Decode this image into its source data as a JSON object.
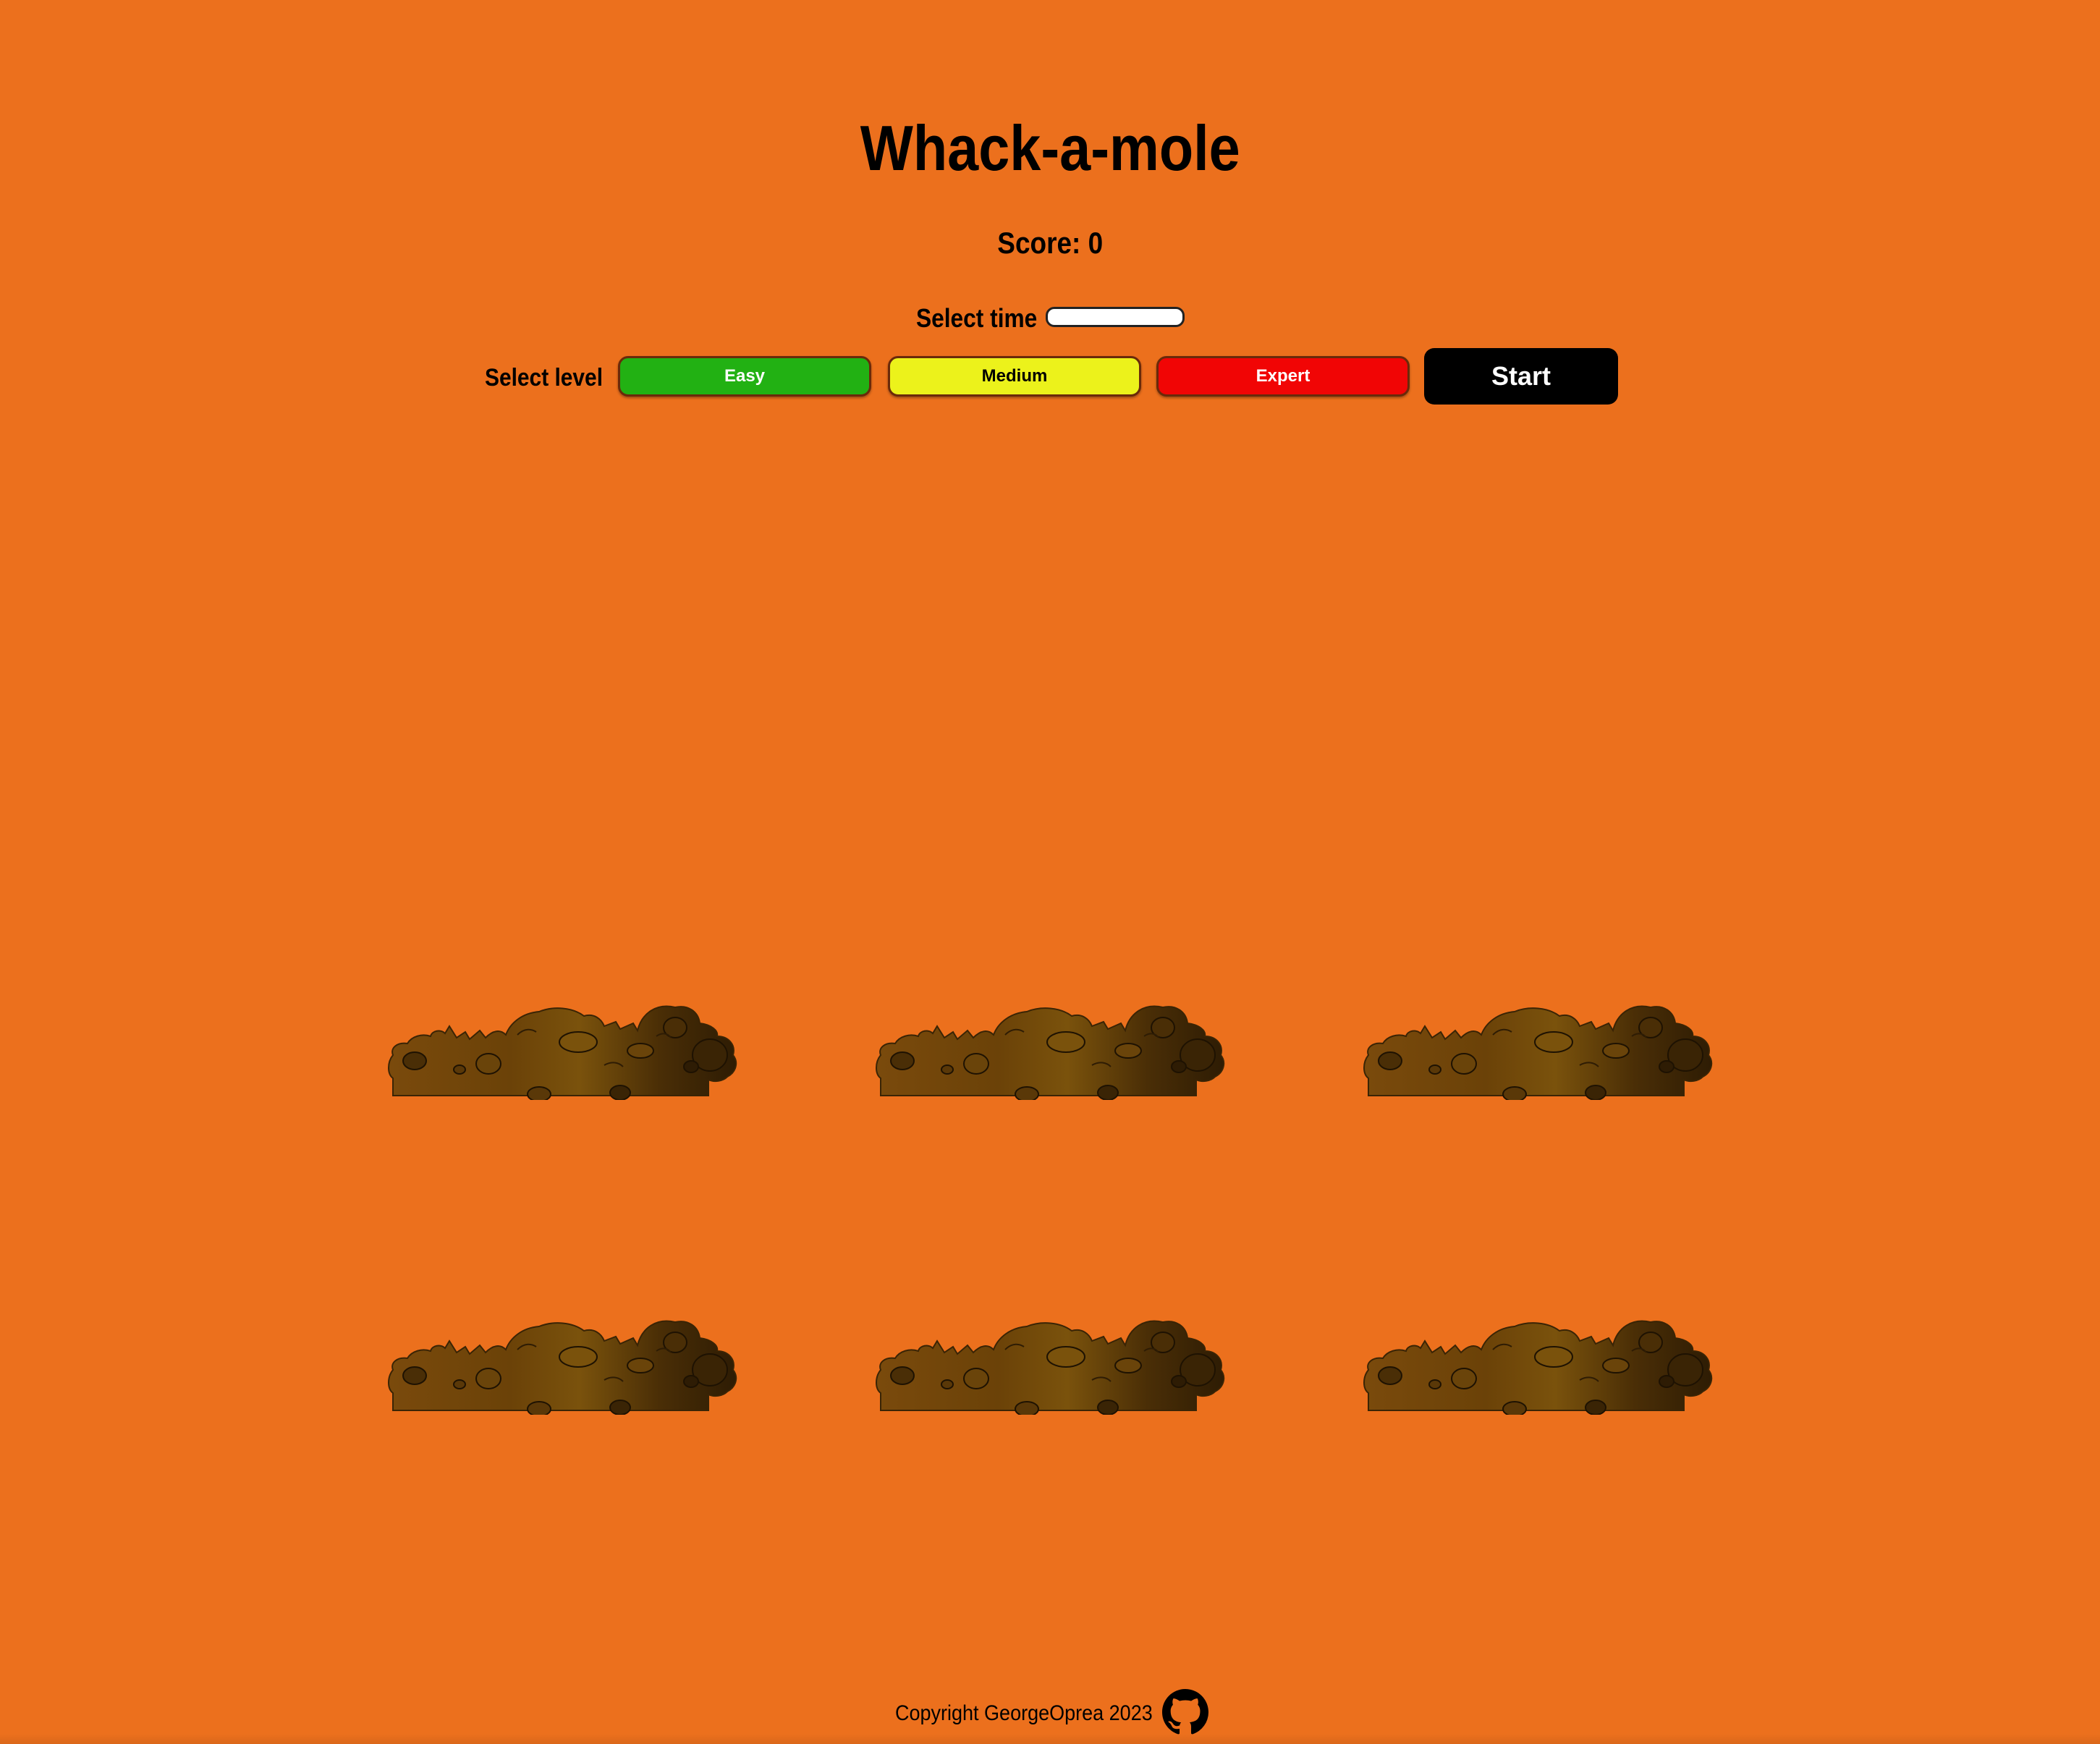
{
  "game": {
    "title": "Whack-a-mole",
    "score_label": "Score: ",
    "score_value": "0"
  },
  "controls": {
    "time_label": "Select time",
    "time_value": "",
    "level_label": "Select level",
    "levels": [
      {
        "label": "Easy",
        "color": "#22b113"
      },
      {
        "label": "Medium",
        "color": "#ecf21b"
      },
      {
        "label": "Expert",
        "color": "#f10505"
      }
    ],
    "start_label": "Start"
  },
  "board": {
    "hole_count": 6,
    "background_color": "#ec701d"
  },
  "footer": {
    "copyright": "Copyright GeorgeOprea 2023",
    "link_icon": "github-icon"
  }
}
